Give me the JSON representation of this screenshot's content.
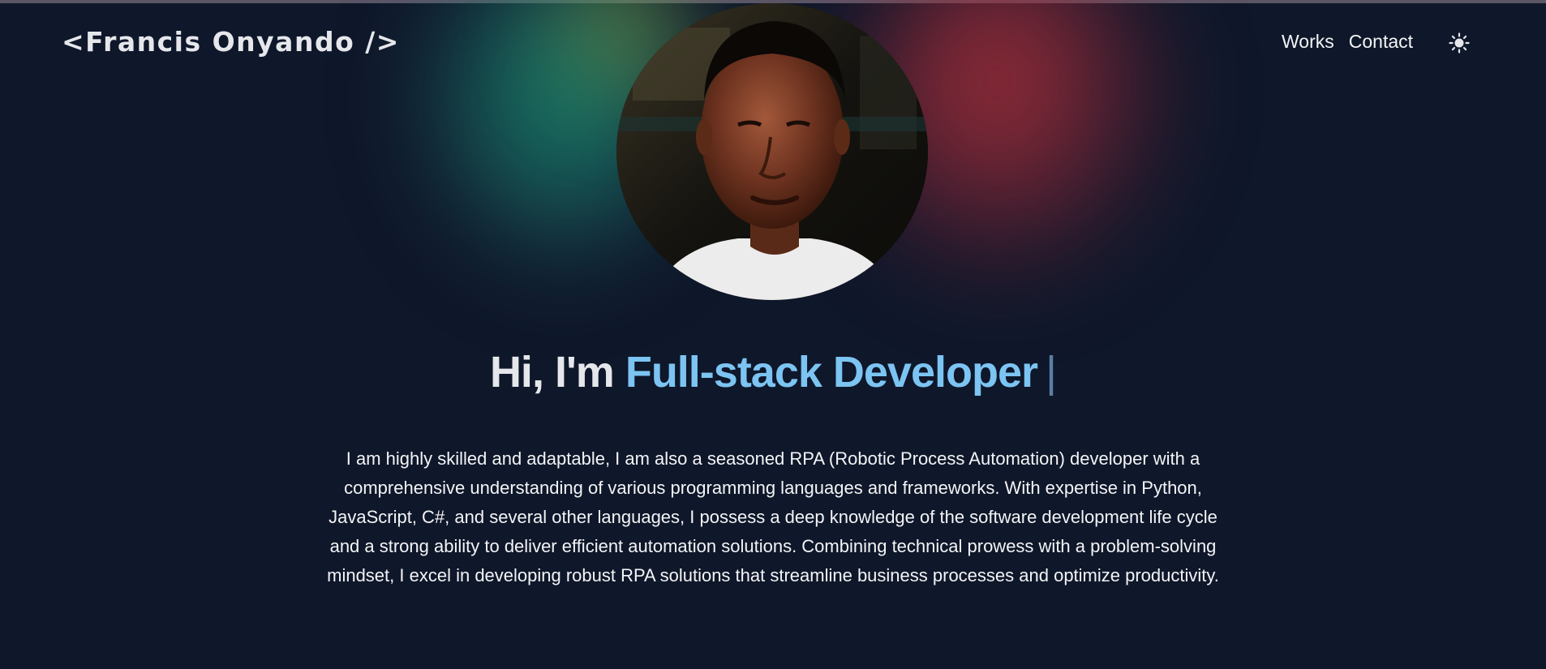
{
  "header": {
    "logo_text": "<Francis Onyando />",
    "nav": [
      {
        "label": "Works"
      },
      {
        "label": "Contact"
      }
    ],
    "theme_toggle_icon": "sun-icon"
  },
  "hero": {
    "avatar_icon": "profile-photo",
    "greeting": "Hi, I'm",
    "role": "Full-stack Developer",
    "cursor": "|",
    "bio": "I am highly skilled and adaptable, I am also a seasoned RPA (Robotic Process Automation) developer with a comprehensive understanding of various programming languages and frameworks. With expertise in Python, JavaScript, C#, and several other languages, I possess a deep knowledge of the software development life cycle and a strong ability to deliver efficient automation solutions. Combining technical prowess with a problem-solving mindset, I excel in developing robust RPA solutions that streamline business processes and optimize productivity."
  },
  "colors": {
    "background": "#0f172a",
    "accent": "#7cc4f2",
    "text": "#e5e7eb"
  }
}
